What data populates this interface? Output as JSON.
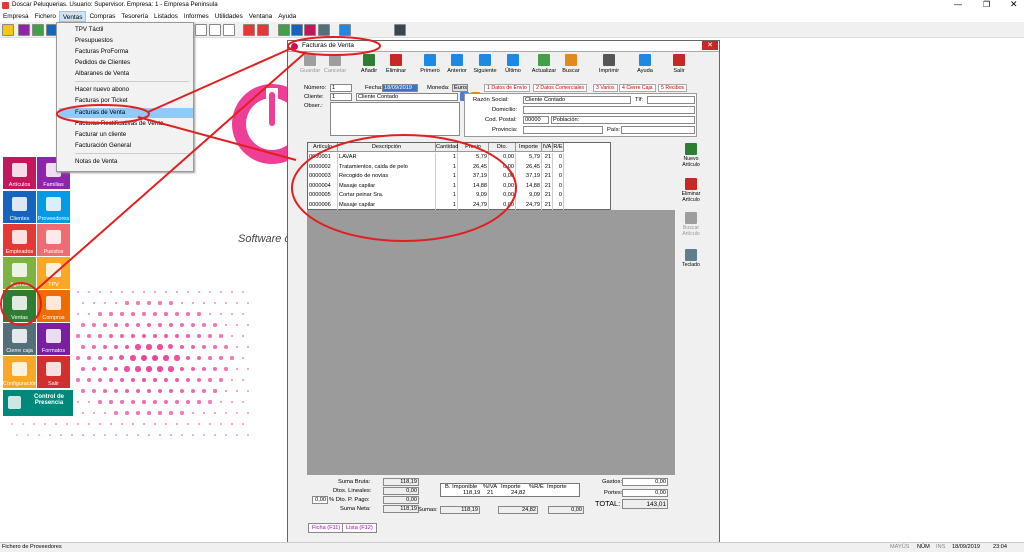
{
  "app": {
    "title": "Doscar Peluquerias. Usuario: Supervisor. Empresa: 1 - Empresa Peninsula"
  },
  "menu": [
    "Empresa",
    "Fichero",
    "Ventas",
    "Compras",
    "Tesorería",
    "Listados",
    "Informes",
    "Utilidades",
    "Ventana",
    "Ayuda"
  ],
  "dropdown": {
    "items": [
      "TPV Táctil",
      "Presupuestos",
      "Facturas ProForma",
      "Pedidos de Clientes",
      "Albaranes de Venta",
      "Hacer nuevo abono",
      "Facturas por Ticket",
      "Facturas de Venta",
      "Facturas Rectificativas de Venta",
      "Facturar un cliente",
      "Facturación General",
      "Notas de Venta"
    ],
    "selected": "Facturas de Venta"
  },
  "brand": {
    "tagline": "Software de"
  },
  "tiles": [
    {
      "label": "Artículos",
      "color": "#c2185b"
    },
    {
      "label": "Familias",
      "color": "#8e24aa"
    },
    {
      "label": "Clientes",
      "color": "#1565c0"
    },
    {
      "label": "Proveedores",
      "color": "#039be5"
    },
    {
      "label": "Empleados",
      "color": "#e53935"
    },
    {
      "label": "Puestos",
      "color": "#ef6c73"
    },
    {
      "label": "Agenda",
      "color": "#7cb342"
    },
    {
      "label": "TPV",
      "color": "#f9a825"
    },
    {
      "label": "Ventas",
      "color": "#2e7d32"
    },
    {
      "label": "Compras",
      "color": "#ef6c00"
    },
    {
      "label": "Cierre caja",
      "color": "#546e7a"
    },
    {
      "label": "Formatos",
      "color": "#7b1fa2"
    },
    {
      "label": "Configuración",
      "color": "#f9a825"
    },
    {
      "label": "Salir",
      "color": "#d32f2f"
    }
  ],
  "control": {
    "label": "Control de Presencia",
    "color": "#00897b"
  },
  "window": {
    "title": "Facturas de Venta",
    "toolbar": [
      "Guardar",
      "Cancelar",
      "Añadir",
      "Eliminar",
      "Primero",
      "Anterior",
      "Siguiente",
      "Último",
      "Actualizar",
      "Buscar",
      "Imprimir",
      "Ayuda",
      "Salir"
    ],
    "header": {
      "numero_label": "Número:",
      "numero": "1",
      "fecha_label": "Fecha:",
      "fecha": "18/09/2019",
      "moneda_label": "Moneda:",
      "moneda": "Euros",
      "cliente_label": "Cliente:",
      "cliente_code": "1",
      "cliente_name": "Cliente Contado",
      "obser_label": "Obser.:"
    },
    "tabs": [
      "1 Datos de Envío",
      "2 Datos Comerciales",
      "3 Varios",
      "4 Cierre Caja",
      "5 Recibos"
    ],
    "envio": {
      "razon_label": "Razón Social:",
      "razon": "Cliente Contado",
      "tlf_label": "Tlf:",
      "domicilio_label": "Domicilio:",
      "cp_label": "Cod. Postal:",
      "cp": "00000",
      "poblacion_label": "Población:",
      "provincia_label": "Provincia:",
      "pais_label": "País:"
    },
    "grid": {
      "headers": [
        "Artículo",
        "Descripción",
        "Cantidad",
        "Precio",
        "Dto.",
        "Importe",
        "IVA",
        "R/E"
      ],
      "rows": [
        [
          "0000001",
          "LAVAR",
          "1",
          "5,79",
          "0,00",
          "5,79",
          "21",
          "0"
        ],
        [
          "0000002",
          "Tratamientos, caida de pelo",
          "1",
          "26,45",
          "0,00",
          "26,45",
          "21",
          "0"
        ],
        [
          "0000003",
          "Recogido de novias",
          "1",
          "37,19",
          "0,00",
          "37,19",
          "21",
          "0"
        ],
        [
          "0000004",
          "Masaje capilar",
          "1",
          "14,88",
          "0,00",
          "14,88",
          "21",
          "0"
        ],
        [
          "0000005",
          "Cortar peinar Sra.",
          "1",
          "9,09",
          "0,00",
          "9,09",
          "21",
          "0"
        ],
        [
          "0000006",
          "Masaje capilar",
          "1",
          "24,79",
          "0,00",
          "24,79",
          "21",
          "0"
        ]
      ]
    },
    "side": [
      "Nuevo Artículo",
      "Eliminar Artículo",
      "Buscar Artículo",
      "Teclado"
    ],
    "totals": {
      "suma_bruta_label": "Suma Bruta:",
      "suma_bruta": "118,19",
      "dtos_label": "Dtos. Lineales:",
      "dtos": "0,00",
      "dto_pp_pct": "0,00",
      "dto_pp_label": "% Dto. P. Pago:",
      "dto_pp": "0,00",
      "suma_neta_label": "Suma Neta:",
      "suma_neta": "118,19",
      "bimp_label": "B. Imponible",
      "iva_label": "%IVA",
      "importe_label": "Importe",
      "re_label": "%R/E",
      "importe2_label": "Importe",
      "bimp": "118,19",
      "iva": "21",
      "iva_imp": "24,82",
      "sumas_label": "Sumas:",
      "sumas_bimp": "118,19",
      "sumas_iva": "24,82",
      "sumas_re": "0,00",
      "gastos_label": "Gastos:",
      "gastos": "0,00",
      "portes_label": "Portes:",
      "portes": "0,00",
      "total_label": "TOTAL:",
      "total": "143,01"
    },
    "ftabs": [
      "Ficha (F11)",
      "Lista (F12)"
    ]
  },
  "status": {
    "left": "Fichero de Proveedores",
    "mayus": "MAYÚS",
    "num": "NÚM",
    "ins": "INS",
    "date": "18/09/2019",
    "time": "23:04"
  }
}
